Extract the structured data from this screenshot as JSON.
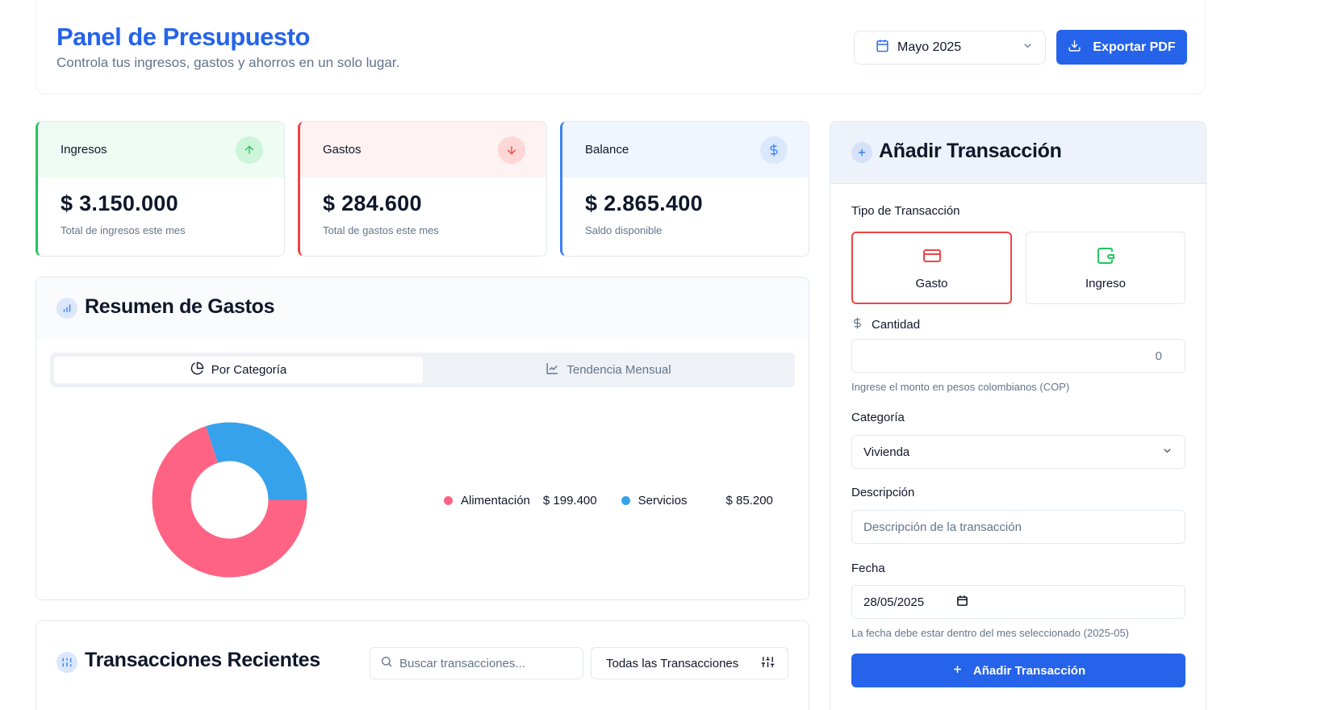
{
  "header": {
    "title": "Panel de Presupuesto",
    "subtitle": "Controla tus ingresos, gastos y ahorros en un solo lugar.",
    "month_selector": "Mayo 2025",
    "export_label": "Exportar PDF"
  },
  "stats": {
    "income": {
      "label": "Ingresos",
      "value": "$ 3.150.000",
      "description": "Total de ingresos este mes"
    },
    "expenses": {
      "label": "Gastos",
      "value": "$ 284.600",
      "description": "Total de gastos este mes"
    },
    "balance": {
      "label": "Balance",
      "value": "$ 2.865.400",
      "description": "Saldo disponible"
    }
  },
  "summary": {
    "title": "Resumen de Gastos",
    "tabs": [
      {
        "label": "Por Categoría",
        "active": true
      },
      {
        "label": "Tendencia Mensual",
        "active": false
      }
    ]
  },
  "chart_data": {
    "type": "pie",
    "categories": [
      "Alimentación",
      "Servicios"
    ],
    "values": [
      199400,
      85200
    ],
    "value_labels": [
      "$ 199.400",
      "$ 85.200"
    ],
    "colors": [
      "#ff6384",
      "#36a2eb"
    ]
  },
  "transactions": {
    "title": "Transacciones Recientes",
    "search_placeholder": "Buscar transacciones...",
    "filter_label": "Todas las Transacciones"
  },
  "add_form": {
    "title": "Añadir Transacción",
    "type_label": "Tipo de Transacción",
    "type_expense": "Gasto",
    "type_income": "Ingreso",
    "amount_label": "Cantidad",
    "amount_value": "0",
    "amount_hint": "Ingrese el monto en pesos colombianos (COP)",
    "category_label": "Categoría",
    "category_value": "Vivienda",
    "description_label": "Descripción",
    "description_placeholder": "Descripción de la transacción",
    "date_label": "Fecha",
    "date_value": "28/05/2025",
    "date_hint": "La fecha debe estar dentro del mes seleccionado (2025-05)",
    "submit_label": "Añadir Transacción"
  },
  "colors": {
    "primary": "#2563eb",
    "income": "#22c55e",
    "expense": "#ef4444",
    "balance": "#3b82f6"
  }
}
